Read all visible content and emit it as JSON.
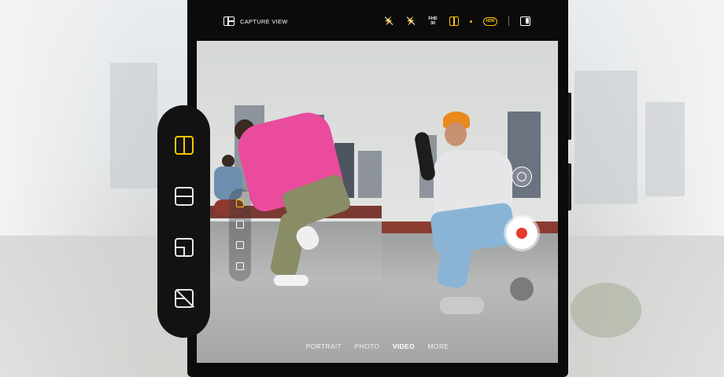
{
  "topbar": {
    "capture_view_label": "CAPTURE VIEW",
    "icons": [
      "capture-view-icon",
      "flash-off-icon",
      "motion-off-icon",
      "fhd-icon",
      "split-view-icon",
      "hdr-icon",
      "panel-icon"
    ],
    "fhd_line1": "FHD",
    "fhd_line2": "30",
    "hdr_label": "HDR"
  },
  "modes": {
    "portrait": "PORTRAIT",
    "photo": "PHOTO",
    "video": "VIDEO",
    "more": "MORE",
    "active": "VIDEO"
  },
  "layout_panel": {
    "options": [
      "split-vertical",
      "split-horizontal",
      "picture-in-picture",
      "picture-in-picture-off"
    ],
    "selected": "split-vertical"
  },
  "colors": {
    "accent": "#ffc400",
    "record": "#e63a2c",
    "device": "#0b0b0b"
  }
}
